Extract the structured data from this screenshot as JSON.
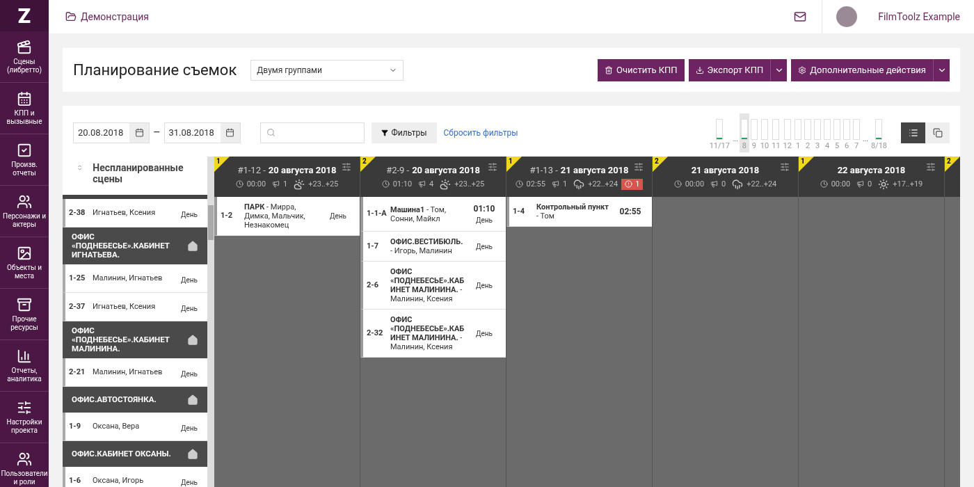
{
  "sidebar": {
    "logo": "Z",
    "items": [
      {
        "label": "Сцены (либретто)"
      },
      {
        "label": "КПП и вызывные"
      },
      {
        "label": "Произв. отчеты"
      },
      {
        "label": "Персонажи и актеры"
      },
      {
        "label": "Объекты и места"
      },
      {
        "label": "Прочие ресурсы"
      },
      {
        "label": "Отчеты, аналитика"
      },
      {
        "label": "Настройки проекта"
      },
      {
        "label": "Пользователи и роли"
      }
    ]
  },
  "topbar": {
    "breadcrumb": "Демонстрация",
    "user": "FilmToolz Example"
  },
  "header": {
    "title": "Планирование съемок",
    "grouping": "Двумя группами",
    "buttons": [
      {
        "label": "Очистить КПП",
        "kind": "clear",
        "dropdown": false
      },
      {
        "label": "Экспорт КПП",
        "kind": "export",
        "dropdown": true
      },
      {
        "label": "Дополнительные действия",
        "kind": "settings",
        "dropdown": true
      }
    ]
  },
  "filters": {
    "date_from": "20.08.2018",
    "date_to": "31.08.2018",
    "dash": "–",
    "filter_button": "Фильтры",
    "reset_link": "Сбросить фильтры"
  },
  "timeline": [
    {
      "kind": "bar",
      "label": "11/17",
      "marked": true,
      "selected": false
    },
    {
      "kind": "gap",
      "label": "..."
    },
    {
      "kind": "bar",
      "label": "8",
      "marked": true,
      "selected": true
    },
    {
      "kind": "bar",
      "label": "9",
      "marked": false,
      "selected": false
    },
    {
      "kind": "bar",
      "label": "10",
      "marked": false,
      "selected": false
    },
    {
      "kind": "bar",
      "label": "11",
      "marked": false,
      "selected": false
    },
    {
      "kind": "bar",
      "label": "12",
      "marked": false,
      "selected": false
    },
    {
      "kind": "bar",
      "label": "1",
      "marked": false,
      "selected": false
    },
    {
      "kind": "bar",
      "label": "2",
      "marked": false,
      "selected": false
    },
    {
      "kind": "bar",
      "label": "3",
      "marked": false,
      "selected": false
    },
    {
      "kind": "bar",
      "label": "4",
      "marked": false,
      "selected": false
    },
    {
      "kind": "bar",
      "label": "5",
      "marked": false,
      "selected": false
    },
    {
      "kind": "bar",
      "label": "6",
      "marked": false,
      "selected": false
    },
    {
      "kind": "bar",
      "label": "7",
      "marked": false,
      "selected": false
    },
    {
      "kind": "gap",
      "label": "..."
    },
    {
      "kind": "bar",
      "label": "8/18",
      "marked": true,
      "selected": false
    }
  ],
  "view_toggle": [
    {
      "kind": "list",
      "selected": true
    },
    {
      "kind": "cards",
      "selected": false
    }
  ],
  "unplanned": {
    "title": "Неспланированные сцены",
    "items": [
      {
        "kind": "scene",
        "number": "2-38",
        "cast": "Игнатьев, Ксения",
        "time_of_day": "День"
      },
      {
        "kind": "location",
        "title": "ОФИС «ПОДНЕБЕСЬЕ».КАБИНЕТ ИГНАТЬЕВА."
      },
      {
        "kind": "scene",
        "number": "1-25",
        "cast": "Малинин, Игнатьев",
        "time_of_day": "День"
      },
      {
        "kind": "scene",
        "number": "2-37",
        "cast": "Игнатьев, Ксения",
        "time_of_day": "День"
      },
      {
        "kind": "location",
        "title": "ОФИС «ПОДНЕБЕСЬЕ».КАБИНЕТ МАЛИНИНА."
      },
      {
        "kind": "scene",
        "number": "2-21",
        "cast": "Малинин, Игнатьев",
        "time_of_day": "День"
      },
      {
        "kind": "location",
        "title": "ОФИС.АВТОСТОЯНКА."
      },
      {
        "kind": "scene",
        "number": "1-9",
        "cast": "Оксана, Вера",
        "time_of_day": "День"
      },
      {
        "kind": "location",
        "title": "ОФИС.КАБИНЕТ ОКСАНЫ."
      },
      {
        "kind": "scene",
        "number": "1-6",
        "cast": "Оксана, Игорь",
        "time_of_day": "День"
      }
    ]
  },
  "days": [
    {
      "group": "1",
      "code": "#1-12 -",
      "date": "20 августа 2018",
      "time": "00:00",
      "count": "1",
      "weather": {
        "kind": "cloudy",
        "temp": "+23..+25"
      },
      "scenes": [
        {
          "number": "1-2",
          "text": "**ПАРК** - Мирра, Димка, Мальчик, Незнакомец",
          "time_of_day": "День"
        }
      ]
    },
    {
      "group": "2",
      "code": "#2-9 -",
      "date": "20 августа 2018",
      "time": "01:10",
      "count": "4",
      "weather": {
        "kind": "cloudy",
        "temp": "+23..+25"
      },
      "scenes": [
        {
          "number": "1-1-А",
          "text": "**Машина1** - Том, Сонни, Майкл",
          "duration": "01:10",
          "time_of_day": "День"
        },
        {
          "number": "1-7",
          "text": "**ОФИС.ВЕСТИБЮЛЬ.** - Игорь, Малинин",
          "time_of_day": "День"
        },
        {
          "number": "2-6",
          "text": "**ОФИС «ПОДНЕБЕСЬЕ».КАБИНЕТ МАЛИНИНА.** - Малинин, Ксения",
          "time_of_day": "День"
        },
        {
          "number": "2-32",
          "text": "**ОФИС «ПОДНЕБЕСЬЕ».КАБИНЕТ МАЛИНИНА.** - Малинин, Ксения",
          "time_of_day": "День"
        }
      ]
    },
    {
      "group": "1",
      "code": "#1-13 -",
      "date": "21 августа 2018",
      "time": "02:55",
      "count": "1",
      "weather": {
        "kind": "rain",
        "temp": "+22..+24"
      },
      "alert": "1",
      "scenes": [
        {
          "number": "1-4",
          "text": "**Контрольный пункт** - Том",
          "duration": "02:55"
        }
      ]
    },
    {
      "group": "2",
      "date": "21 августа 2018",
      "time": "00:00",
      "count": "0",
      "weather": {
        "kind": "rain",
        "temp": "+22..+24"
      }
    },
    {
      "group": "1",
      "date": "22 августа 2018",
      "time": "00:00",
      "count": "0",
      "weather": {
        "kind": "sunny",
        "temp": "+17..+19"
      }
    },
    {
      "group": "2"
    }
  ]
}
